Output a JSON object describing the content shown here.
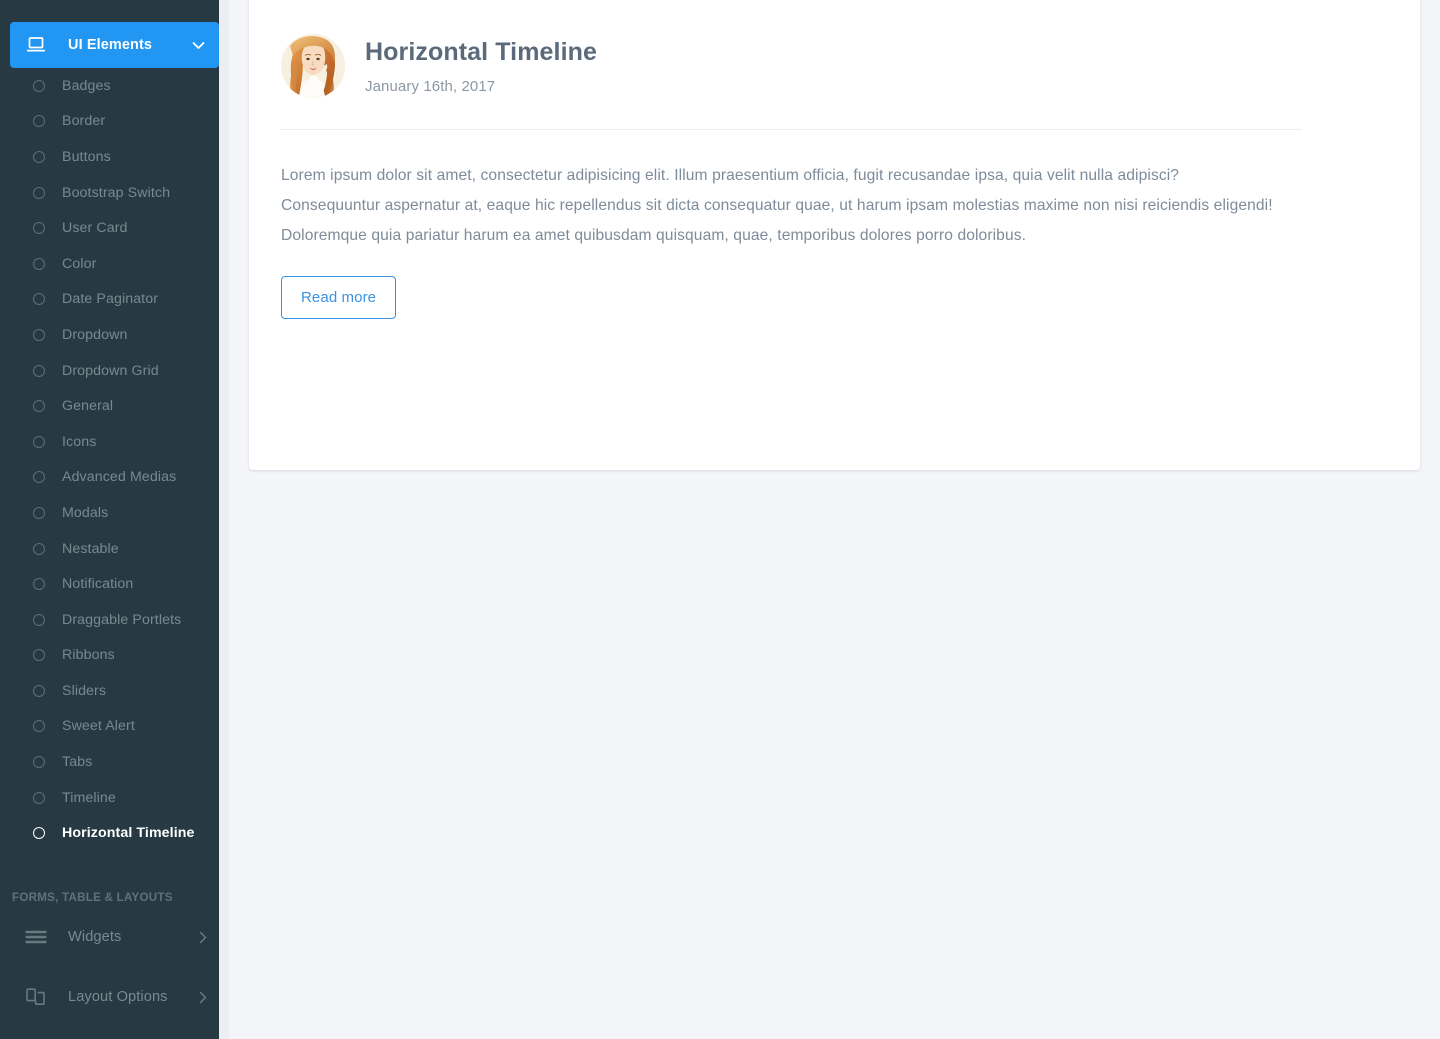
{
  "sidebar": {
    "active_parent": {
      "label": "UI Elements",
      "icon": "laptop-icon",
      "caret": "chevron-down-icon",
      "accent_color": "#2196f3"
    },
    "sub_items": [
      {
        "label": "Badges",
        "active": false
      },
      {
        "label": "Border",
        "active": false
      },
      {
        "label": "Buttons",
        "active": false
      },
      {
        "label": "Bootstrap Switch",
        "active": false
      },
      {
        "label": "User Card",
        "active": false
      },
      {
        "label": "Color",
        "active": false
      },
      {
        "label": "Date Paginator",
        "active": false
      },
      {
        "label": "Dropdown",
        "active": false
      },
      {
        "label": "Dropdown Grid",
        "active": false
      },
      {
        "label": "General",
        "active": false
      },
      {
        "label": "Icons",
        "active": false
      },
      {
        "label": "Advanced Medias",
        "active": false
      },
      {
        "label": "Modals",
        "active": false
      },
      {
        "label": "Nestable",
        "active": false
      },
      {
        "label": "Notification",
        "active": false
      },
      {
        "label": "Draggable Portlets",
        "active": false
      },
      {
        "label": "Ribbons",
        "active": false
      },
      {
        "label": "Sliders",
        "active": false
      },
      {
        "label": "Sweet Alert",
        "active": false
      },
      {
        "label": "Tabs",
        "active": false
      },
      {
        "label": "Timeline",
        "active": false
      },
      {
        "label": "Horizontal Timeline",
        "active": true
      }
    ],
    "section_heading": "FORMS, TABLE & LAYOUTS",
    "parents": [
      {
        "label": "Widgets",
        "icon": "hamburger-icon",
        "caret": "chevron-right-icon"
      },
      {
        "label": "Layout Options",
        "icon": "copy-layers-icon",
        "caret": "chevron-right-icon"
      }
    ],
    "background_color": "#273a44"
  },
  "main": {
    "card": {
      "avatar": "user-avatar-photo",
      "title": "Horizontal Timeline",
      "date": "January 16th, 2017",
      "body": "Lorem ipsum dolor sit amet, consectetur adipisicing elit. Illum praesentium officia, fugit recusandae ipsa, quia velit nulla adipisci? Consequuntur aspernatur at, eaque hic repellendus sit dicta consequatur quae, ut harum ipsam molestias maxime non nisi reiciendis eligendi! Doloremque quia pariatur harum ea amet quibusdam quisquam, quae, temporibus dolores porro doloribus.",
      "read_more_label": "Read more",
      "link_color": "#3a92e3"
    },
    "background_color": "#f4f5f9"
  }
}
